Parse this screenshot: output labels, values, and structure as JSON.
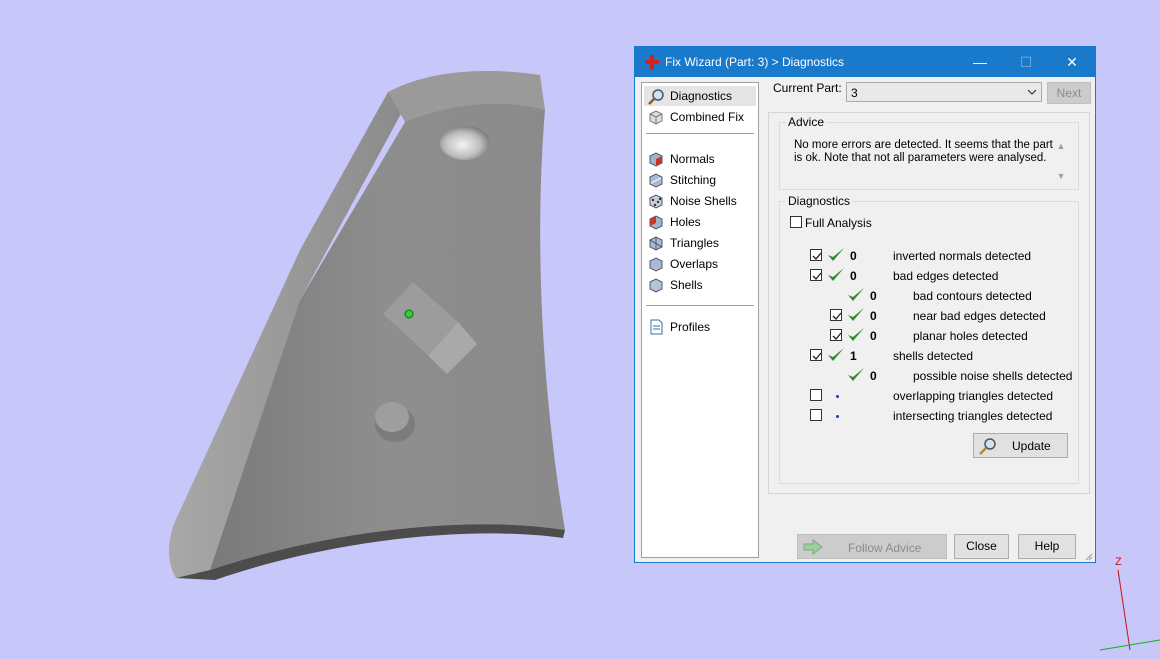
{
  "window": {
    "title": "Fix Wizard (Part: 3) > Diagnostics",
    "minimize": "—",
    "maximize": "☐",
    "close": "✕"
  },
  "nav": {
    "top_items": [
      {
        "label": "Diagnostics",
        "icon": "magnifier-icon",
        "selected": true
      },
      {
        "label": "Combined Fix",
        "icon": "cube-icon"
      }
    ],
    "fix_items": [
      {
        "label": "Normals",
        "icon": "normals-icon"
      },
      {
        "label": "Stitching",
        "icon": "stitching-icon"
      },
      {
        "label": "Noise Shells",
        "icon": "noise-shells-icon"
      },
      {
        "label": "Holes",
        "icon": "holes-icon"
      },
      {
        "label": "Triangles",
        "icon": "triangles-icon"
      },
      {
        "label": "Overlaps",
        "icon": "overlaps-icon"
      },
      {
        "label": "Shells",
        "icon": "shells-icon"
      }
    ],
    "profiles": {
      "label": "Profiles",
      "icon": "document-icon"
    }
  },
  "current_part": {
    "label": "Current Part:",
    "value": "3",
    "next_label": "Next"
  },
  "advice": {
    "title": "Advice",
    "text": "No more errors are detected. It seems that the part is ok. Note that not all parameters were analysed."
  },
  "diagnostics": {
    "title": "Diagnostics",
    "full_analysis_label": "Full Analysis",
    "full_analysis_checked": false,
    "rows": [
      {
        "checkbox": true,
        "checked": true,
        "status": "ok",
        "count": "0",
        "label": "inverted normals detected",
        "indent": 0
      },
      {
        "checkbox": true,
        "checked": true,
        "status": "ok",
        "count": "0",
        "label": "bad edges detected",
        "indent": 0
      },
      {
        "checkbox": false,
        "checked": false,
        "status": "ok",
        "count": "0",
        "label": "bad contours detected",
        "indent": 1
      },
      {
        "checkbox": true,
        "checked": true,
        "status": "ok",
        "count": "0",
        "label": "near bad edges detected",
        "indent": 1
      },
      {
        "checkbox": true,
        "checked": true,
        "status": "ok",
        "count": "0",
        "label": "planar holes detected",
        "indent": 1
      },
      {
        "checkbox": true,
        "checked": true,
        "status": "ok",
        "count": "1",
        "label": "shells detected",
        "indent": 0
      },
      {
        "checkbox": false,
        "checked": false,
        "status": "ok",
        "count": "0",
        "label": "possible noise shells detected",
        "indent": 1
      },
      {
        "checkbox": true,
        "checked": false,
        "status": "none",
        "count": "",
        "label": "overlapping triangles detected",
        "indent": 0
      },
      {
        "checkbox": true,
        "checked": false,
        "status": "none",
        "count": "",
        "label": "intersecting triangles detected",
        "indent": 0
      }
    ],
    "update_label": "Update"
  },
  "footer": {
    "follow_advice_label": "Follow Advice",
    "close_label": "Close",
    "help_label": "Help"
  },
  "axis": {
    "z_label": "Z"
  },
  "colors": {
    "background": "#c7c7f9",
    "titlebar": "#1979ca",
    "check_green": "#2e8b2e",
    "part_gray": "#8c8c8c"
  }
}
